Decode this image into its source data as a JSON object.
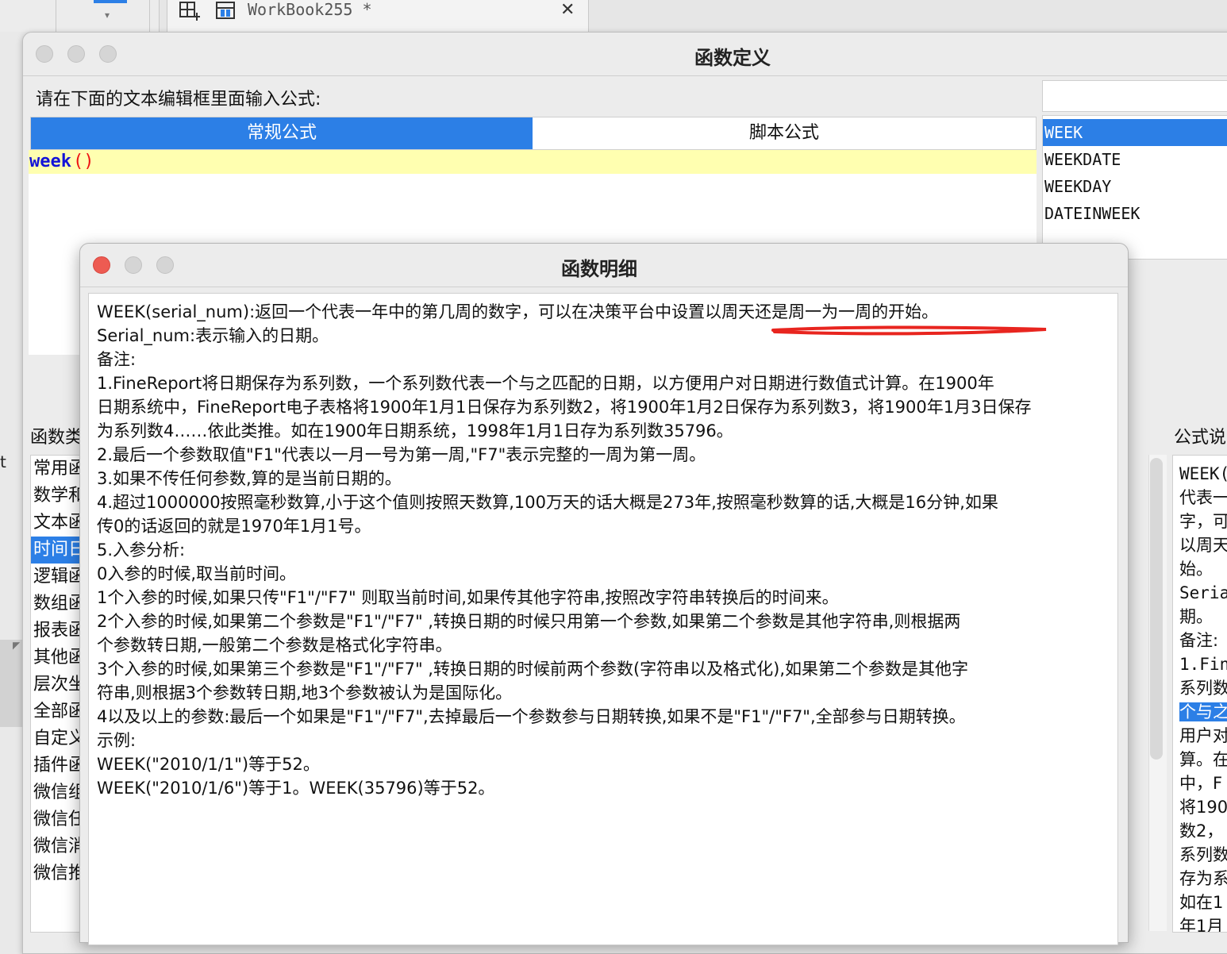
{
  "topbar": {
    "tab_title": "WorkBook255 *",
    "close_glyph": "✕"
  },
  "main_dialog": {
    "title": "函数定义",
    "prompt": "请在下面的文本编辑框里面输入公式:",
    "tabs": [
      "常规公式",
      "脚本公式"
    ],
    "editor": {
      "fn": "week",
      "parens": "()"
    },
    "search_value": "",
    "function_list": [
      "WEEK",
      "WEEKDATE",
      "WEEKDAY",
      "DATEINWEEK"
    ],
    "category_label": "函数类",
    "categories": [
      "常用函",
      "数学和",
      "文本函",
      "时间日",
      "逻辑函",
      "数组函",
      "报表函",
      "其他函",
      "层次坐",
      "全部函",
      "自定义",
      "插件函",
      "微信组",
      "微信任",
      "微信消",
      "微信推"
    ],
    "description_label": "公式说",
    "description_lines": [
      "WEEK(",
      "代表一",
      "字，可",
      "以周天",
      "始。",
      "Seria",
      "期。",
      "备注:",
      "1.Fin",
      "系列数",
      "个与之",
      "用户对",
      "算。在",
      "中，F",
      "将190",
      "数2，",
      "系列数",
      "存为系",
      "如在1",
      "年1月"
    ],
    "left_edge_text": "t"
  },
  "detail_dialog": {
    "title": "函数明细",
    "lines": [
      "WEEK(serial_num):返回一个代表一年中的第几周的数字，可以在决策平台中设置以周天还是周一为一周的开始。",
      "Serial_num:表示输入的日期。",
      "备注:",
      "1.FineReport将日期保存为系列数，一个系列数代表一个与之匹配的日期，以方便用户对日期进行数值式计算。在1900年",
      "日期系统中，FineReport电子表格将1900年1月1日保存为系列数2，将1900年1月2日保存为系列数3，将1900年1月3日保存",
      "为系列数4……依此类推。如在1900年日期系统，1998年1月1日存为系列数35796。",
      "2.最后一个参数取值\"F1\"代表以一月一号为第一周,\"F7\"表示完整的一周为第一周。",
      "3.如果不传任何参数,算的是当前日期的。",
      "4.超过1000000按照毫秒数算,小于这个值则按照天数算,100万天的话大概是273年,按照毫秒数算的话,大概是16分钟,如果",
      "传0的话返回的就是1970年1月1号。",
      "5.入参分析:",
      "0入参的时候,取当前时间。",
      "1个入参的时候,如果只传\"F1\"/\"F7\" 则取当前时间,如果传其他字符串,按照改字符串转换后的时间来。",
      "2个入参的时候,如果第二个参数是\"F1\"/\"F7\" ,转换日期的时候只用第一个参数,如果第二个参数是其他字符串,则根据两",
      "个参数转日期,一般第二个参数是格式化字符串。",
      "3个入参的时候,如果第三个参数是\"F1\"/\"F7\" ,转换日期的时候前两个参数(字符串以及格式化),如果第二个参数是其他字",
      "符串,则根据3个参数转日期,地3个参数被认为是国际化。",
      "4以及以上的参数:最后一个如果是\"F1\"/\"F7\",去掉最后一个参数参与日期转换,如果不是\"F1\"/\"F7\",全部参与日期转换。",
      "示例:",
      "WEEK(\"2010/1/1\")等于52。",
      "WEEK(\"2010/1/6\")等于1。WEEK(35796)等于52。"
    ]
  },
  "colors": {
    "accent": "#2c7fe6",
    "editor_highlight": "#ffffb0",
    "close_red": "#ed5b52",
    "annotation_red": "#e8251f",
    "keyword_blue": "#1313d8"
  }
}
